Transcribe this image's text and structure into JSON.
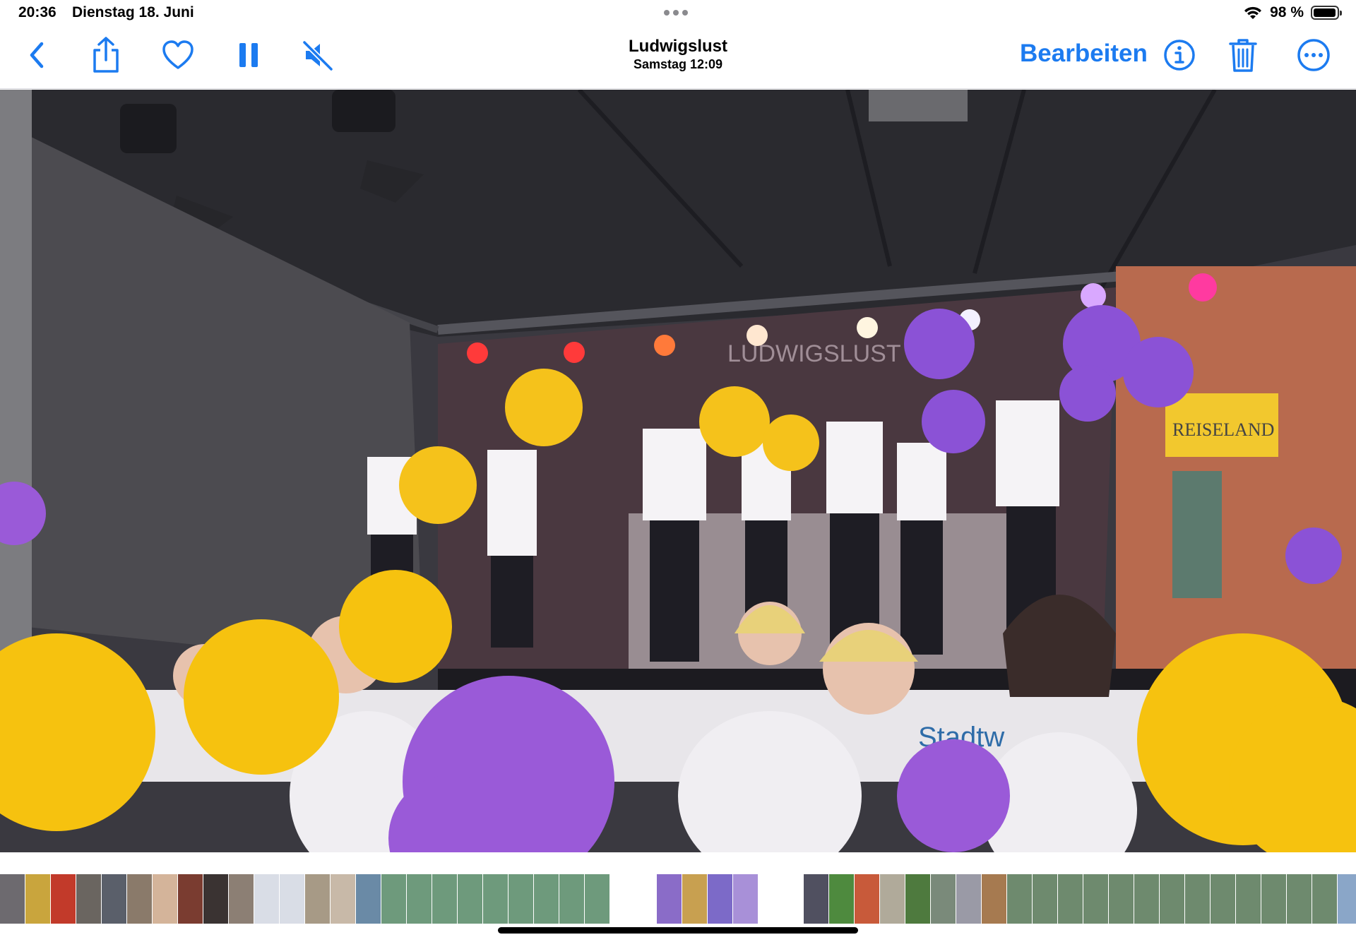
{
  "status_bar": {
    "time": "20:36",
    "date": "Dienstag 18. Juni",
    "battery_percent": "98 %",
    "battery_level": 0.98,
    "icons": [
      "wifi-icon",
      "battery-icon"
    ]
  },
  "toolbar": {
    "title": "Ludwigslust",
    "subtitle": "Samstag  12:09",
    "edit_label": "Bearbeiten",
    "accent_color": "#1c7bf0",
    "icons": [
      "back-chevron-icon",
      "share-icon",
      "heart-icon",
      "pause-icon",
      "muted-speaker-icon",
      "info-icon",
      "trash-icon",
      "more-ellipsis-icon"
    ]
  },
  "media": {
    "kind": "video-frame",
    "stage_banner_text": "LUDWIGSLUST",
    "shop_sign_text": "REISELAND",
    "banner_text": "Stadtw"
  },
  "thumbnail_strip": {
    "colors": [
      "#6d6a6f",
      "#c9a53d",
      "#c23a2a",
      "#6a6560",
      "#5a5f6a",
      "#8a7a6a",
      "#d4b49a",
      "#7a3c30",
      "#3a3332",
      "#8c7f74",
      "#d9dde6",
      "#d9dde6",
      "#a79a86",
      "#c8b9a8",
      "#6a8aa6",
      "#6e9a7c",
      "#6e9a7c",
      "#6e9a7c",
      "#6e9a7c",
      "#6e9a7c",
      "#6e9a7c",
      "#6e9a7c",
      "#6e9a7c",
      "#6e9a7c",
      "#ffffff",
      "#8a6cc8",
      "#c8a050",
      "#7c6ac8",
      "#a890d8",
      "#ffffff",
      "#505060",
      "#4e8a3e",
      "#c85a3a",
      "#b0aa9a",
      "#4e7a3e",
      "#7a8a7a",
      "#9a9aa6",
      "#a67a50",
      "#6e8a6e",
      "#6e8a6e",
      "#6e8a6e",
      "#6e8a6e",
      "#6e8a6e",
      "#6e8a6e",
      "#6e8a6e",
      "#6e8a6e",
      "#6e8a6e",
      "#6e8a6e",
      "#6e8a6e",
      "#6e8a6e",
      "#6e8a6e",
      "#8aa6c8",
      "#c8503a",
      "#6e8a6e",
      "#4e7a9e"
    ]
  }
}
